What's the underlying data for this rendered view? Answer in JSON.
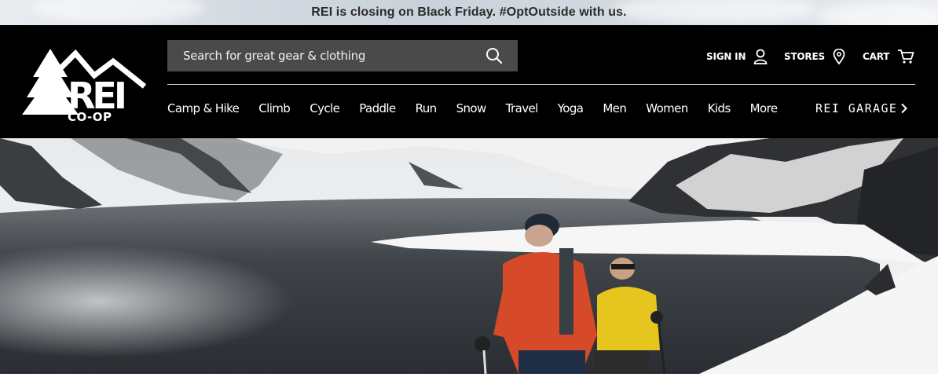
{
  "promo": {
    "text": "REI is closing on Black Friday. #OptOutside with us."
  },
  "brand": {
    "logo_text_top": "REI",
    "logo_text_bottom": "CO-OP"
  },
  "search": {
    "placeholder": "Search for great gear & clothing",
    "icon": "search-icon"
  },
  "utility_nav": {
    "sign_in": {
      "label": "SIGN IN",
      "icon": "user-icon"
    },
    "stores": {
      "label": "STORES",
      "icon": "location-pin-icon"
    },
    "cart": {
      "label": "CART",
      "icon": "cart-icon"
    }
  },
  "main_nav": {
    "items": [
      "Camp & Hike",
      "Climb",
      "Cycle",
      "Paddle",
      "Run",
      "Snow",
      "Travel",
      "Yoga",
      "Men",
      "Women",
      "Kids",
      "More"
    ]
  },
  "garage": {
    "label": "REI GARAGE",
    "icon": "chevron-right-icon"
  },
  "colors": {
    "header_bg": "#000000",
    "search_bg": "#4a4a4a",
    "text": "#ffffff"
  }
}
